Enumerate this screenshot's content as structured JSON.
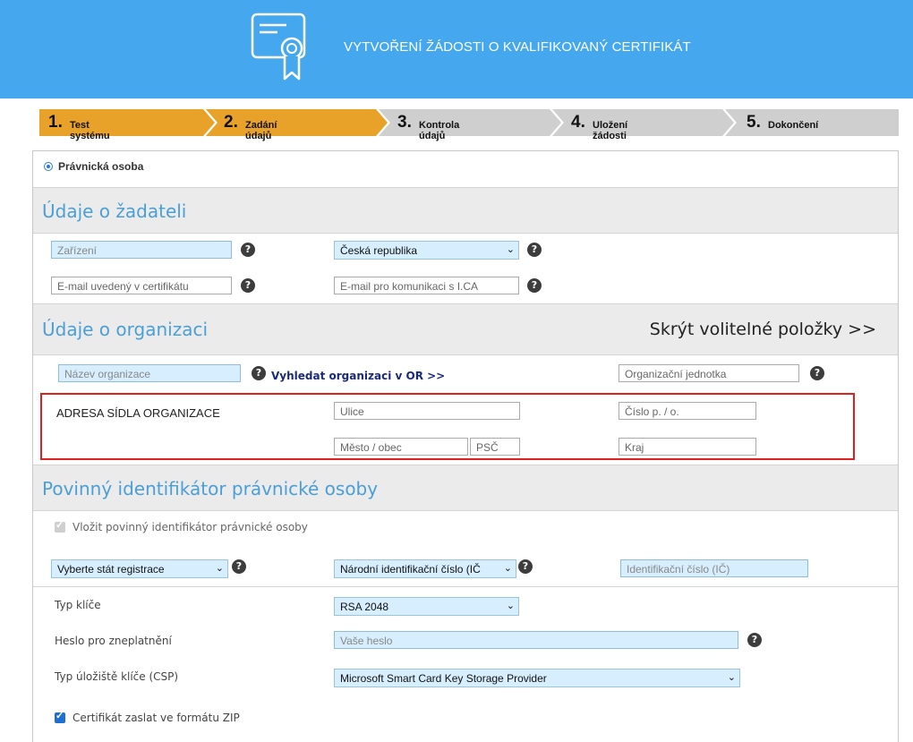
{
  "header": {
    "title": "VYTVOŘENÍ ŽÁDOSTI O KVALIFIKOVANÝ CERTIFIKÁT",
    "icon": "certificate-icon",
    "bg_color": "#45a8ee"
  },
  "steps": [
    {
      "num": "1.",
      "label": "Test systému",
      "state": "done",
      "color": "#e8a22a"
    },
    {
      "num": "2.",
      "label": "Zadání údajů",
      "state": "active",
      "color": "#e8a22a"
    },
    {
      "num": "3.",
      "label": "Kontrola údajů",
      "state": "pending",
      "color": "#cfcfcf"
    },
    {
      "num": "4.",
      "label": "Uložení žádosti",
      "state": "pending",
      "color": "#cfcfcf"
    },
    {
      "num": "5.",
      "label": "Dokončení",
      "state": "pending",
      "color": "#cfcfcf"
    }
  ],
  "person_type": {
    "label": "Právnická osoba",
    "selected": true
  },
  "applicant": {
    "heading": "Údaje o žadateli",
    "device_placeholder": "Zařízení",
    "country_value": "Česká republika",
    "email_cert_placeholder": "E-mail uvedený v certifikátu",
    "email_comm_placeholder": "E-mail pro komunikaci s I.CA"
  },
  "organization": {
    "heading": "Údaje o organizaci",
    "toggle_optional": "Skrýt volitelné položky >>",
    "name_placeholder": "Název organizace",
    "search_link": "Vyhledat organizaci v OR >>",
    "unit_placeholder": "Organizační jednotka",
    "address_label": "ADRESA SÍDLA ORGANIZACE",
    "street_placeholder": "Ulice",
    "house_no_placeholder": "Číslo p. / o.",
    "city_placeholder": "Město / obec",
    "zip_placeholder": "PSČ",
    "region_placeholder": "Kraj",
    "highlight_color": "#e0201e"
  },
  "identifier": {
    "heading": "Povinný identifikátor právnické osoby",
    "insert_checkbox_label": "Vložit povinný identifikátor právnické osoby",
    "insert_checked": true,
    "country_select": "Vyberte stát registrace",
    "id_type_select": "Národní identifikační číslo (IČ",
    "id_placeholder": "Identifikační číslo (IČ)"
  },
  "key": {
    "type_label": "Typ klíče",
    "type_value": "RSA 2048",
    "revoke_label": "Heslo pro zneplatnění",
    "revoke_placeholder": "Vaše heslo",
    "csp_label": "Typ úložiště klíče (CSP)",
    "csp_value": "Microsoft Smart Card Key Storage Provider",
    "zip_checkbox_label": "Certifikát zaslat ve formátu ZIP",
    "zip_checked": true
  },
  "help_glyph": "?",
  "caret_glyph": "⌄"
}
